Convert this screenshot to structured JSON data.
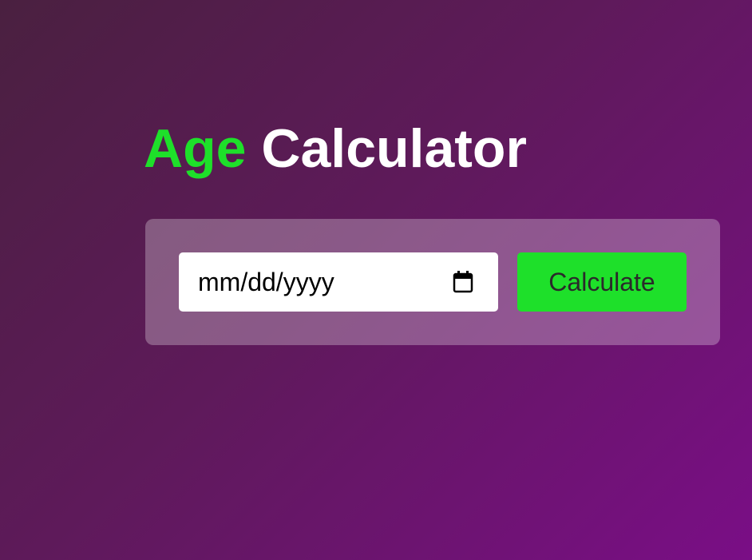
{
  "header": {
    "title_accent": "Age",
    "title_rest": "Calculator"
  },
  "form": {
    "date_input": {
      "placeholder": "mm/dd/yyyy",
      "value": ""
    },
    "calculate_label": "Calculate"
  },
  "icons": {
    "date_picker": "calendar-icon"
  },
  "colors": {
    "accent": "#1ee02a",
    "title": "#ffffff",
    "background_start": "#4a2040",
    "background_end": "#7a0e86",
    "card": "rgba(255,255,255,0.28)"
  }
}
